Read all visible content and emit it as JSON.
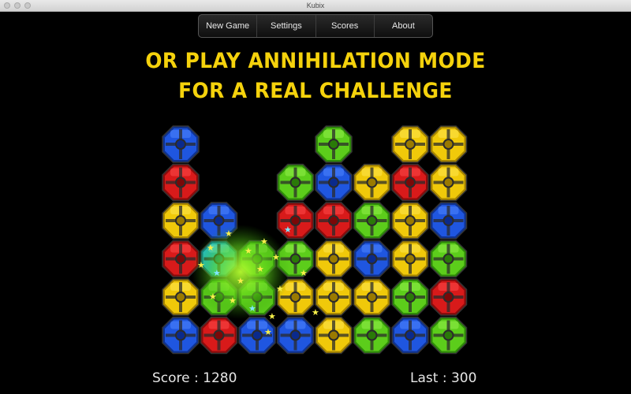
{
  "window": {
    "title": "Kubix"
  },
  "menu": [
    "New Game",
    "Settings",
    "Scores",
    "About"
  ],
  "banner": {
    "line1": "OR PLAY ANNIHILATION MODE",
    "line2": "FOR A REAL CHALLENGE"
  },
  "score": {
    "label": "Score : 1280",
    "last": "Last : 300"
  },
  "colors": {
    "blue": "#1f56e0",
    "red": "#d81a1a",
    "yellow": "#f0c90a",
    "green": "#5ccd1b",
    "banner": "#f5d20c"
  },
  "grid": {
    "columns": 8,
    "rows": 6,
    "cells": [
      [
        "blue",
        null,
        null,
        null,
        "green",
        null,
        "yellow",
        "yellow"
      ],
      [
        "red",
        null,
        null,
        "green",
        "blue",
        "yellow",
        "red",
        "yellow"
      ],
      [
        "yellow",
        "blue",
        null,
        "red",
        "red",
        "green",
        "yellow",
        "blue"
      ],
      [
        "red",
        "cyan",
        "green",
        "green",
        "yellow",
        "blue",
        "yellow",
        "green"
      ],
      [
        "yellow",
        "green",
        "green",
        "yellow",
        "yellow",
        "yellow",
        "green",
        "red"
      ],
      [
        "blue",
        "red",
        "blue",
        "blue",
        "yellow",
        "green",
        "blue",
        "green"
      ]
    ]
  }
}
